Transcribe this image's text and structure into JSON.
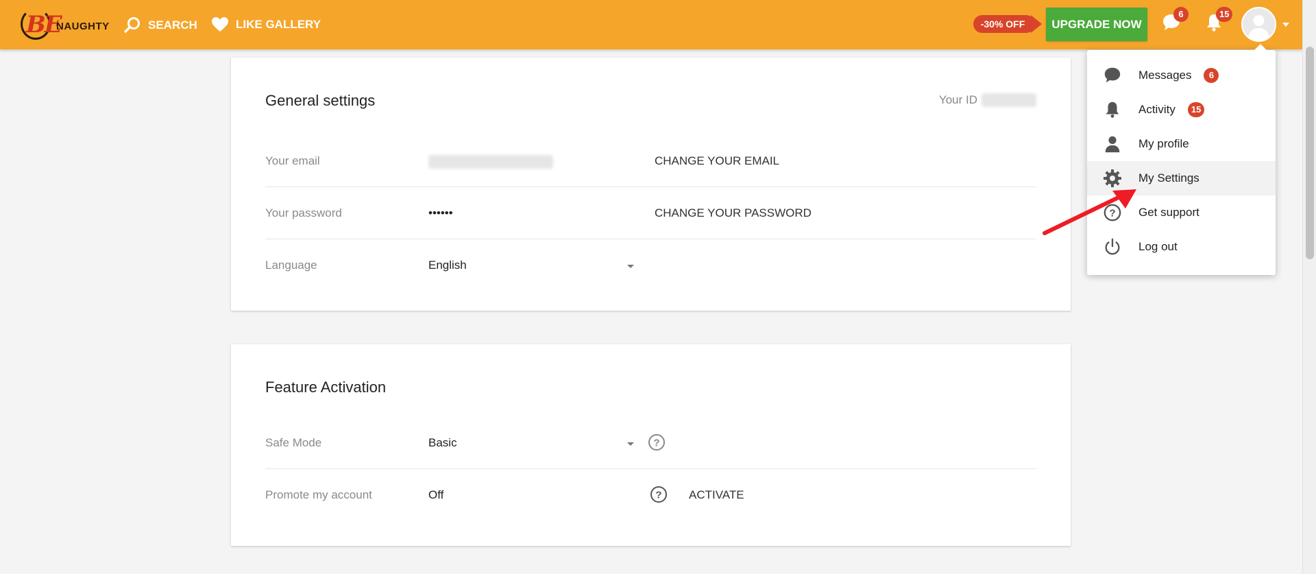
{
  "header": {
    "logo_text": "BENAUGHTY",
    "logo_be": "BE",
    "logo_naughty": "NAUGHTY",
    "nav": [
      {
        "label": "SEARCH",
        "icon": "search-icon"
      },
      {
        "label": "LIKE GALLERY",
        "icon": "heart-icon"
      }
    ],
    "promo_label": "-30% OFF",
    "upgrade_label": "UPGRADE NOW",
    "messages_count": "6",
    "notifications_count": "15"
  },
  "general": {
    "title": "General settings",
    "your_id_label": "Your ID",
    "email_label": "Your email",
    "email_action": "CHANGE YOUR EMAIL",
    "password_label": "Your password",
    "password_value": "••••••",
    "password_action": "CHANGE YOUR PASSWORD",
    "language_label": "Language",
    "language_value": "English"
  },
  "features": {
    "title": "Feature Activation",
    "safe_mode_label": "Safe Mode",
    "safe_mode_value": "Basic",
    "promote_label": "Promote my account",
    "promote_value": "Off",
    "promote_action": "ACTIVATE"
  },
  "menu": {
    "items": [
      {
        "label": "Messages",
        "icon": "chat-bubble-icon",
        "badge": "6"
      },
      {
        "label": "Activity",
        "icon": "bell-icon",
        "badge": "15"
      },
      {
        "label": "My profile",
        "icon": "person-icon"
      },
      {
        "label": "My Settings",
        "icon": "gear-icon",
        "active": true
      },
      {
        "label": "Get support",
        "icon": "help-circle-icon"
      },
      {
        "label": "Log out",
        "icon": "power-icon"
      }
    ]
  },
  "colors": {
    "header": "#f5a52a",
    "upgrade": "#4aaa3a",
    "badge": "#d8442a",
    "annotation_arrow": "#ee1c24"
  }
}
